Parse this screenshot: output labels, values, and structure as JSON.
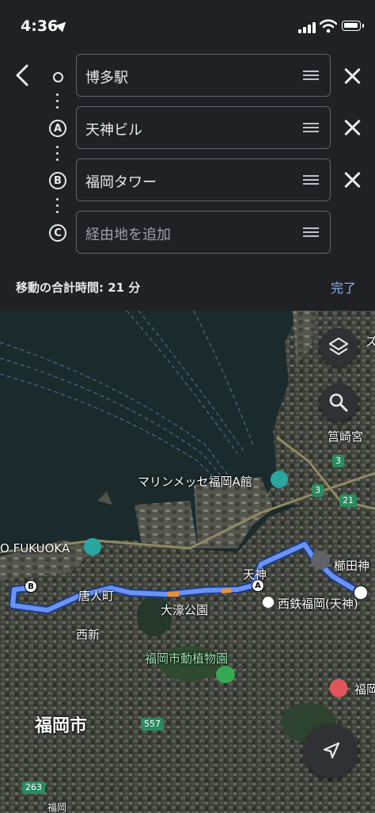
{
  "status_bar": {
    "time": "4:36"
  },
  "route": {
    "stops": [
      {
        "marker": "",
        "name": "博多駅"
      },
      {
        "marker": "A",
        "name": "天神ビル"
      },
      {
        "marker": "B",
        "name": "福岡タワー"
      },
      {
        "marker": "C",
        "name": "",
        "placeholder": "経由地を追加"
      }
    ],
    "summary": "移動の合計時間: 21 分",
    "done_label": "完了"
  },
  "map": {
    "labels": {
      "marine_messe": "マリンメッセ福岡A館",
      "fukuoka_tower": "O FUKUOKA",
      "tenjin": "天神",
      "nishitetsu": "西鉄福岡(天神)",
      "tojinmachi": "唐人町",
      "nishijin": "西新",
      "ohori_park": "大濠公園",
      "zoo": "福岡市動植物園",
      "fukuoka_city": "福岡市",
      "hakozaki": "筥崎宮",
      "kushida": "櫛田神",
      "fukuoka_right": "福岡",
      "kanji_edge": "福岡",
      "partial_top_right": "ズ"
    },
    "road_numbers": [
      "3",
      "3",
      "21",
      "557",
      "263"
    ],
    "colors": {
      "route": "#4f7cf0",
      "accent": "#8ab4f8"
    }
  }
}
